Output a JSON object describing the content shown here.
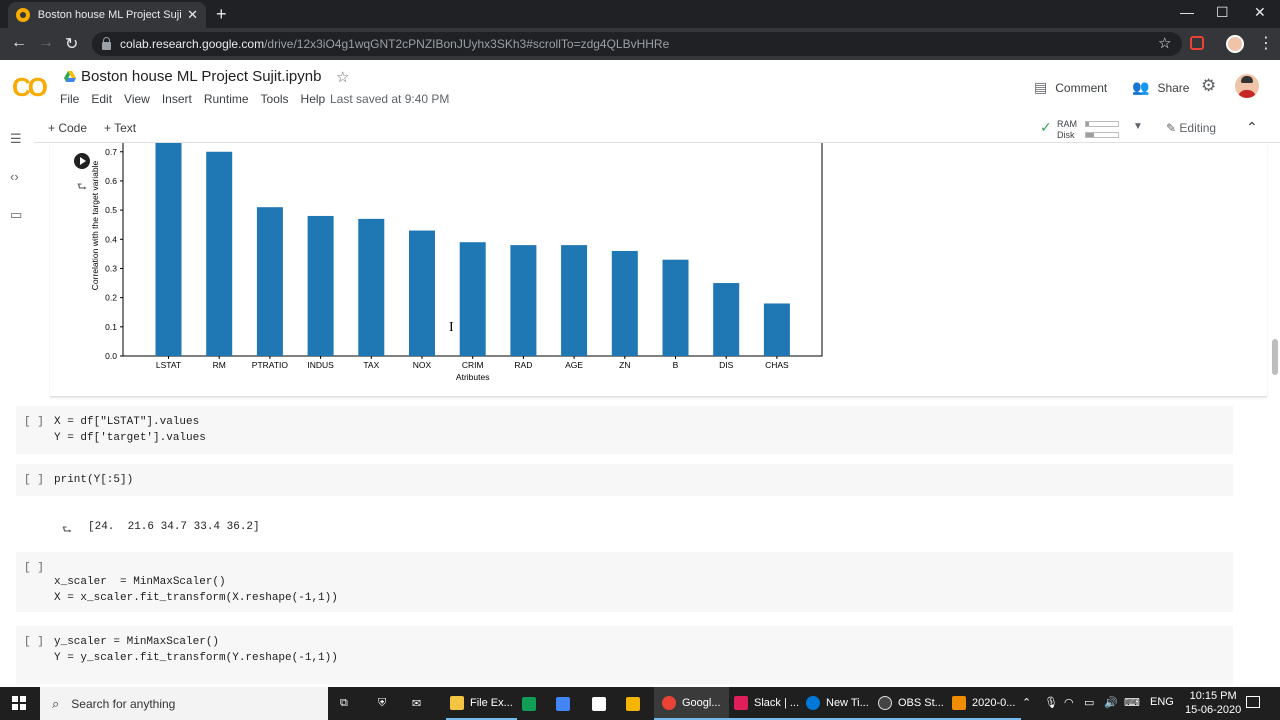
{
  "browser": {
    "tab_title": "Boston house ML Project Sujit.ip",
    "tab_close": "✕",
    "new_tab": "+",
    "url_host": "colab.research.google.com",
    "url_path": "/drive/12x3iO4g1wqGNT2cPNZIBonJUyhx3SKh3#scrollTo=zdg4QLBvHHRe",
    "win_min": "—",
    "win_max": "☐",
    "win_close": "✕"
  },
  "colab": {
    "logo": "CO",
    "doc_title": "Boston house ML Project Sujit.ipynb",
    "menu": [
      "File",
      "Edit",
      "View",
      "Insert",
      "Runtime",
      "Tools",
      "Help"
    ],
    "last_saved": "Last saved at 9:40 PM",
    "comment_label": "Comment",
    "share_label": "Share",
    "add_code": "+ Code",
    "add_text": "+ Text",
    "ram_label": "RAM",
    "disk_label": "Disk",
    "ram_usage": 0.1,
    "disk_usage": 0.25,
    "editing_label": "Editing"
  },
  "chart_data": {
    "type": "bar",
    "categories": [
      "LSTAT",
      "RM",
      "PTRATIO",
      "INDUS",
      "TAX",
      "NOX",
      "CRIM",
      "RAD",
      "AGE",
      "ZN",
      "B",
      "DIS",
      "CHAS"
    ],
    "values": [
      0.74,
      0.7,
      0.51,
      0.48,
      0.47,
      0.43,
      0.39,
      0.38,
      0.38,
      0.36,
      0.33,
      0.25,
      0.18
    ],
    "xlabel": "Atributes",
    "ylabel": "Correlation with the target variable",
    "yticks": [
      "0.0",
      "0.1",
      "0.2",
      "0.3",
      "0.4",
      "0.5",
      "0.6",
      "0.7"
    ],
    "ylim": [
      0,
      0.73
    ],
    "bar_color": "#1f77b4",
    "grid": false
  },
  "cells": [
    {
      "bracket": "[ ]",
      "lines": [
        "X = df[\"LSTAT\"].values",
        "Y = df['target'].values"
      ]
    },
    {
      "bracket": "[ ]",
      "lines": [
        "print(Y[:5])"
      ]
    },
    {
      "bracket": "[ ]",
      "lines": [
        "x_scaler  = MinMaxScaler()",
        "X = x_scaler.fit_transform(X.reshape(-1,1))"
      ]
    },
    {
      "bracket": "[ ]",
      "lines": [
        "y_scaler = MinMaxScaler()",
        "Y = y_scaler.fit_transform(Y.reshape(-1,1))"
      ]
    }
  ],
  "print_output": "[24.  21.6 34.7 33.4 36.2]",
  "taskbar": {
    "search_placeholder": "Search for anything",
    "items": [
      {
        "label": "File Ex...",
        "color": "#f4c542"
      },
      {
        "label": "Googl...",
        "color": "#ea4335"
      },
      {
        "label": "Slack | ...",
        "color": "#e01e5a"
      },
      {
        "label": "New Ti...",
        "color": "#0078d7"
      },
      {
        "label": "OBS St...",
        "color": "#444444"
      },
      {
        "label": "2020-0...",
        "color": "#f08c00"
      }
    ],
    "lang": "ENG",
    "time": "10:15 PM",
    "date": "15-06-2020"
  }
}
